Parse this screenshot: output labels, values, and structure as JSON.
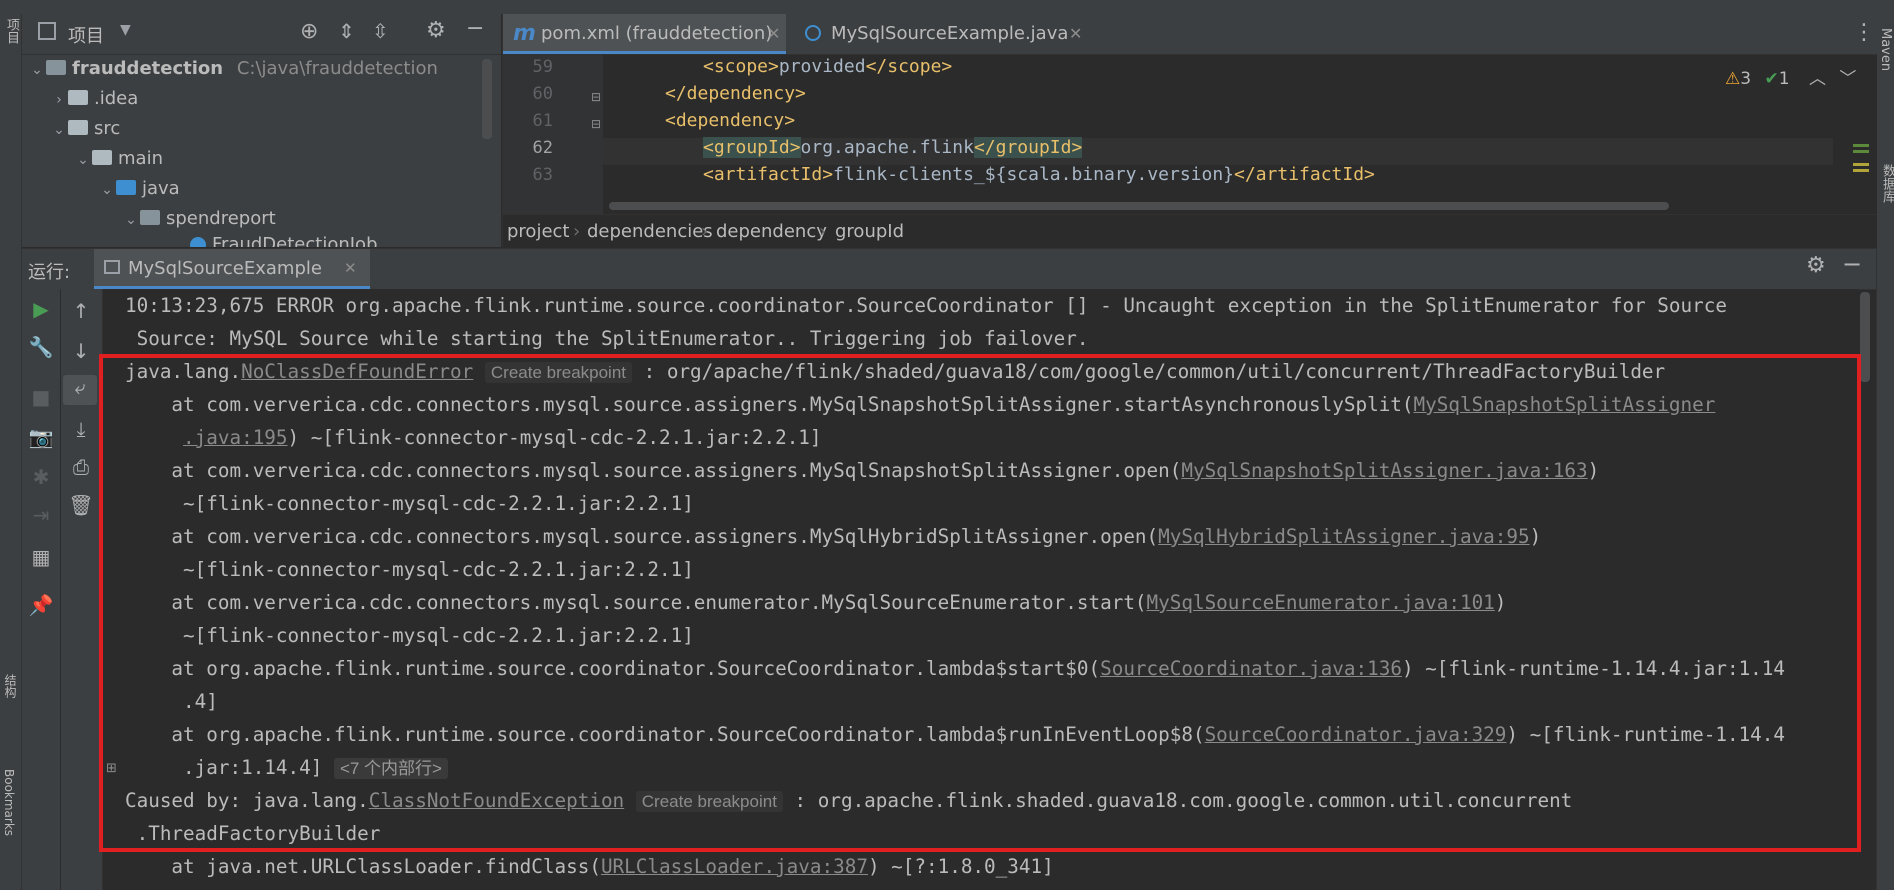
{
  "left_strip": {
    "project_label": "项目",
    "structure_label": "结构",
    "bookmarks_label": "Bookmarks"
  },
  "right_strip": {
    "maven_label": "Maven",
    "database_label": "数据库"
  },
  "project_panel": {
    "title": "项目",
    "tree": [
      {
        "name": "frauddetection",
        "path": "C:\\java\\frauddetection"
      },
      {
        "name": ".idea"
      },
      {
        "name": "src"
      },
      {
        "name": "main"
      },
      {
        "name": "java"
      },
      {
        "name": "spendreport"
      },
      {
        "name": "FraudDetectionJob"
      }
    ]
  },
  "editor": {
    "tabs": [
      {
        "label": "pom.xml (frauddetection)"
      },
      {
        "label": "MySqlSourceExample.java"
      }
    ],
    "inspection": {
      "warnings": "3",
      "ok": "1"
    },
    "lines": [
      {
        "num": "59",
        "pre": "<scope>",
        "text": "provided",
        "post": "</scope>"
      },
      {
        "num": "60",
        "text": "</dependency>"
      },
      {
        "num": "61",
        "text": "<dependency>"
      },
      {
        "num": "62",
        "pre": "<groupId>",
        "text": "org.apache.flink",
        "post": "</groupId>"
      },
      {
        "num": "63",
        "pre": "<artifactId>",
        "text": "flink-clients_${scala.binary.version}",
        "post": "</artifactId>"
      }
    ],
    "breadcrumb": [
      "project",
      "dependencies",
      "dependency",
      "groupId"
    ]
  },
  "run": {
    "label": "运行:",
    "config_tab": "MySqlSourceExample",
    "console": {
      "l1": "10:13:23,675 ERROR org.apache.flink.runtime.source.coordinator.SourceCoordinator [] - Uncaught exception in the SplitEnumerator for Source",
      "l2": " Source: MySQL Source while starting the SplitEnumerator.. Triggering job failover.",
      "l3_pre": "java.lang.",
      "l3_link": "NoClassDefFoundError",
      "bp": "Create breakpoint",
      "l3_post": " : org/apache/flink/shaded/guava18/com/google/common/util/concurrent/ThreadFactoryBuilder",
      "l4_pre": "    at com.ververica.cdc.connectors.mysql.source.assigners.MySqlSnapshotSplitAssigner.startAsynchronouslySplit(",
      "l4_link": "MySqlSnapshotSplitAssigner",
      "l5_link": ".java:195",
      "l5_post": ") ~[flink-connector-mysql-cdc-2.2.1.jar:2.2.1]",
      "l6_pre": "    at com.ververica.cdc.connectors.mysql.source.assigners.MySqlSnapshotSplitAssigner.open(",
      "l6_link": "MySqlSnapshotSplitAssigner.java:163",
      "l6_post": ")",
      "jar": "     ~[flink-connector-mysql-cdc-2.2.1.jar:2.2.1]",
      "l8_pre": "    at com.ververica.cdc.connectors.mysql.source.assigners.MySqlHybridSplitAssigner.open(",
      "l8_link": "MySqlHybridSplitAssigner.java:95",
      "l8_post": ")",
      "l10_pre": "    at com.ververica.cdc.connectors.mysql.source.enumerator.MySqlSourceEnumerator.start(",
      "l10_link": "MySqlSourceEnumerator.java:101",
      "l10_post": ")",
      "l12_pre": "    at org.apache.flink.runtime.source.coordinator.SourceCoordinator.lambda$start$0(",
      "l12_link": "SourceCoordinator.java:136",
      "l12_post": ") ~[flink-runtime-1.14.4.jar:1.14",
      "l13": "     .4]",
      "l14_pre": "    at org.apache.flink.runtime.source.coordinator.SourceCoordinator.lambda$runInEventLoop$8(",
      "l14_link": "SourceCoordinator.java:329",
      "l14_post": ") ~[flink-runtime-1.14.4",
      "l15": "     .jar:1.14.4]",
      "l15_fold": "<7 个内部行>",
      "l16_pre": "Caused by: java.lang.",
      "l16_link": "ClassNotFoundException",
      "l16_post": " : org.apache.flink.shaded.guava18.com.google.common.util.concurrent",
      "l17": " .ThreadFactoryBuilder",
      "l18_pre": "    at java.net.URLClassLoader.findClass(",
      "l18_link": "URLClassLoader.java:387",
      "l18_post": ") ~[?:1.8.0_341]"
    }
  },
  "colors": {
    "error_box": "#e02020",
    "accent": "#4a88c7",
    "run_green": "#499c54"
  }
}
